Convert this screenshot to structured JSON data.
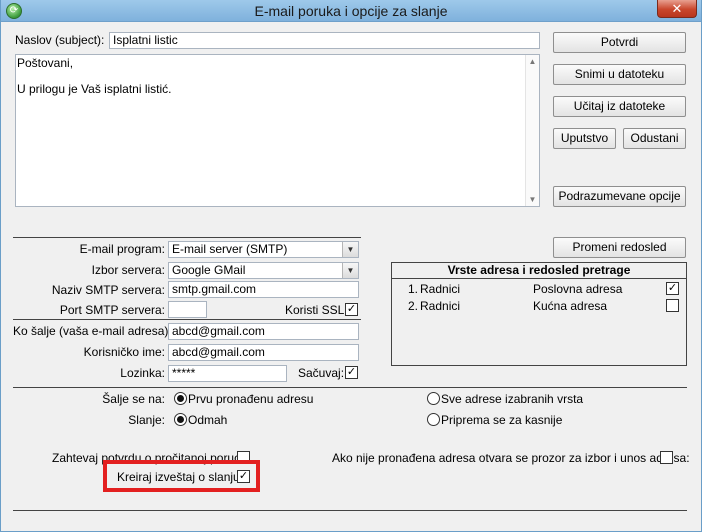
{
  "window": {
    "title": "E-mail poruka i opcije za slanje",
    "close_glyph": "✕",
    "app_icon": "app-icon"
  },
  "subject": {
    "label": "Naslov (subject):",
    "value": "Isplatni listic"
  },
  "body": {
    "lines": [
      "Poštovani,",
      "",
      "U prilogu je Vaš isplatni listić."
    ]
  },
  "buttons": {
    "potvrdi": "Potvrdi",
    "snimi": "Snimi u datoteku",
    "ucitaj": "Učitaj iz datoteke",
    "uputstvo": "Uputstvo",
    "odustani": "Odustani",
    "podrazumevane": "Podrazumevane opcije",
    "promeni_redosled": "Promeni redosled"
  },
  "smtp": {
    "program_label": "E-mail program:",
    "program_value": "E-mail server (SMTP)",
    "server_label": "Izbor servera:",
    "server_value": "Google GMail",
    "smtp_name_label": "Naziv SMTP servera:",
    "smtp_name_value": "smtp.gmail.com",
    "port_label": "Port SMTP servera:",
    "port_value": "",
    "ssl_label": "Koristi SSL:",
    "ssl_checked": "✓"
  },
  "sender": {
    "from_label": "Ko šalje (vaša e-mail adresa):",
    "from_value": "abcd@gmail.com",
    "user_label": "Korisničko ime:",
    "user_value": "abcd@gmail.com",
    "password_label": "Lozinka:",
    "password_value": "*****",
    "save_label": "Sačuvaj:",
    "save_checked": "✓"
  },
  "address_panel": {
    "title": "Vrste adresa i redosled pretrage",
    "rows": [
      {
        "index": "1.",
        "who": "Radnici",
        "type": "Poslovna adresa",
        "check": "✓"
      },
      {
        "index": "2.",
        "who": "Radnici",
        "type": "Kućna adresa",
        "check": ""
      }
    ]
  },
  "send_to": {
    "label": "Šalje se na:",
    "opt1": "Prvu pronađenu adresu",
    "opt2": "Sve adrese izabranih vrsta"
  },
  "sending": {
    "label": "Slanje:",
    "opt1": "Odmah",
    "opt2": "Priprema se za kasnije"
  },
  "options": {
    "read_receipt_label": "Zahtevaj potvrdu o pročitanoj poruci:",
    "read_receipt_check": "",
    "no_address_label": "Ako nije pronađena adresa otvara se prozor za izbor i unos adresa:",
    "no_address_check": "",
    "report_label": "Kreiraj izveštaj o slanju:",
    "report_check": "✓"
  },
  "colors": {
    "highlight": "#e32020",
    "titlebar": "#8fbde4",
    "close": "#c9462c"
  }
}
